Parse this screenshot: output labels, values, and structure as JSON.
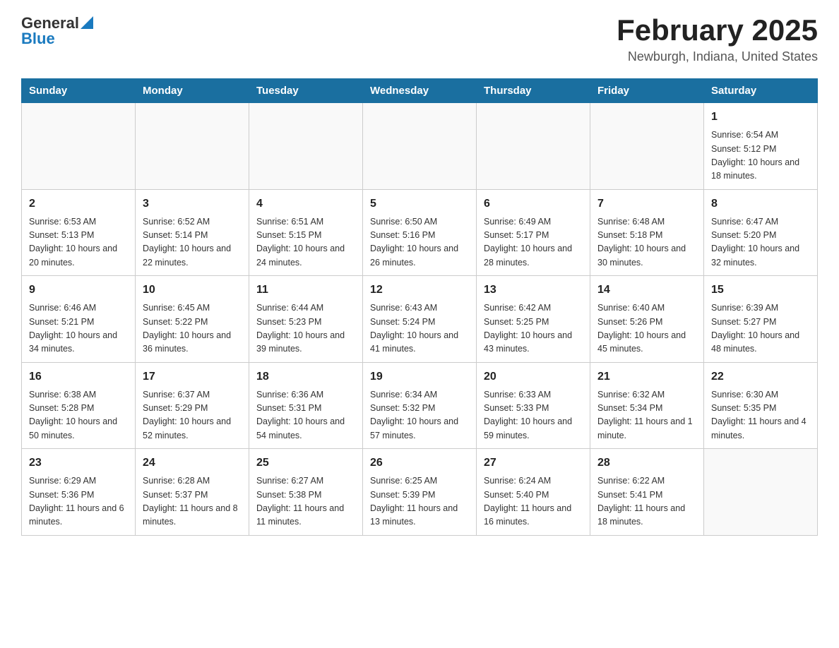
{
  "header": {
    "logo_general": "General",
    "logo_blue": "Blue",
    "title": "February 2025",
    "subtitle": "Newburgh, Indiana, United States"
  },
  "weekdays": [
    "Sunday",
    "Monday",
    "Tuesday",
    "Wednesday",
    "Thursday",
    "Friday",
    "Saturday"
  ],
  "weeks": [
    [
      {
        "day": "",
        "info": ""
      },
      {
        "day": "",
        "info": ""
      },
      {
        "day": "",
        "info": ""
      },
      {
        "day": "",
        "info": ""
      },
      {
        "day": "",
        "info": ""
      },
      {
        "day": "",
        "info": ""
      },
      {
        "day": "1",
        "info": "Sunrise: 6:54 AM\nSunset: 5:12 PM\nDaylight: 10 hours and 18 minutes."
      }
    ],
    [
      {
        "day": "2",
        "info": "Sunrise: 6:53 AM\nSunset: 5:13 PM\nDaylight: 10 hours and 20 minutes."
      },
      {
        "day": "3",
        "info": "Sunrise: 6:52 AM\nSunset: 5:14 PM\nDaylight: 10 hours and 22 minutes."
      },
      {
        "day": "4",
        "info": "Sunrise: 6:51 AM\nSunset: 5:15 PM\nDaylight: 10 hours and 24 minutes."
      },
      {
        "day": "5",
        "info": "Sunrise: 6:50 AM\nSunset: 5:16 PM\nDaylight: 10 hours and 26 minutes."
      },
      {
        "day": "6",
        "info": "Sunrise: 6:49 AM\nSunset: 5:17 PM\nDaylight: 10 hours and 28 minutes."
      },
      {
        "day": "7",
        "info": "Sunrise: 6:48 AM\nSunset: 5:18 PM\nDaylight: 10 hours and 30 minutes."
      },
      {
        "day": "8",
        "info": "Sunrise: 6:47 AM\nSunset: 5:20 PM\nDaylight: 10 hours and 32 minutes."
      }
    ],
    [
      {
        "day": "9",
        "info": "Sunrise: 6:46 AM\nSunset: 5:21 PM\nDaylight: 10 hours and 34 minutes."
      },
      {
        "day": "10",
        "info": "Sunrise: 6:45 AM\nSunset: 5:22 PM\nDaylight: 10 hours and 36 minutes."
      },
      {
        "day": "11",
        "info": "Sunrise: 6:44 AM\nSunset: 5:23 PM\nDaylight: 10 hours and 39 minutes."
      },
      {
        "day": "12",
        "info": "Sunrise: 6:43 AM\nSunset: 5:24 PM\nDaylight: 10 hours and 41 minutes."
      },
      {
        "day": "13",
        "info": "Sunrise: 6:42 AM\nSunset: 5:25 PM\nDaylight: 10 hours and 43 minutes."
      },
      {
        "day": "14",
        "info": "Sunrise: 6:40 AM\nSunset: 5:26 PM\nDaylight: 10 hours and 45 minutes."
      },
      {
        "day": "15",
        "info": "Sunrise: 6:39 AM\nSunset: 5:27 PM\nDaylight: 10 hours and 48 minutes."
      }
    ],
    [
      {
        "day": "16",
        "info": "Sunrise: 6:38 AM\nSunset: 5:28 PM\nDaylight: 10 hours and 50 minutes."
      },
      {
        "day": "17",
        "info": "Sunrise: 6:37 AM\nSunset: 5:29 PM\nDaylight: 10 hours and 52 minutes."
      },
      {
        "day": "18",
        "info": "Sunrise: 6:36 AM\nSunset: 5:31 PM\nDaylight: 10 hours and 54 minutes."
      },
      {
        "day": "19",
        "info": "Sunrise: 6:34 AM\nSunset: 5:32 PM\nDaylight: 10 hours and 57 minutes."
      },
      {
        "day": "20",
        "info": "Sunrise: 6:33 AM\nSunset: 5:33 PM\nDaylight: 10 hours and 59 minutes."
      },
      {
        "day": "21",
        "info": "Sunrise: 6:32 AM\nSunset: 5:34 PM\nDaylight: 11 hours and 1 minute."
      },
      {
        "day": "22",
        "info": "Sunrise: 6:30 AM\nSunset: 5:35 PM\nDaylight: 11 hours and 4 minutes."
      }
    ],
    [
      {
        "day": "23",
        "info": "Sunrise: 6:29 AM\nSunset: 5:36 PM\nDaylight: 11 hours and 6 minutes."
      },
      {
        "day": "24",
        "info": "Sunrise: 6:28 AM\nSunset: 5:37 PM\nDaylight: 11 hours and 8 minutes."
      },
      {
        "day": "25",
        "info": "Sunrise: 6:27 AM\nSunset: 5:38 PM\nDaylight: 11 hours and 11 minutes."
      },
      {
        "day": "26",
        "info": "Sunrise: 6:25 AM\nSunset: 5:39 PM\nDaylight: 11 hours and 13 minutes."
      },
      {
        "day": "27",
        "info": "Sunrise: 6:24 AM\nSunset: 5:40 PM\nDaylight: 11 hours and 16 minutes."
      },
      {
        "day": "28",
        "info": "Sunrise: 6:22 AM\nSunset: 5:41 PM\nDaylight: 11 hours and 18 minutes."
      },
      {
        "day": "",
        "info": ""
      }
    ]
  ]
}
